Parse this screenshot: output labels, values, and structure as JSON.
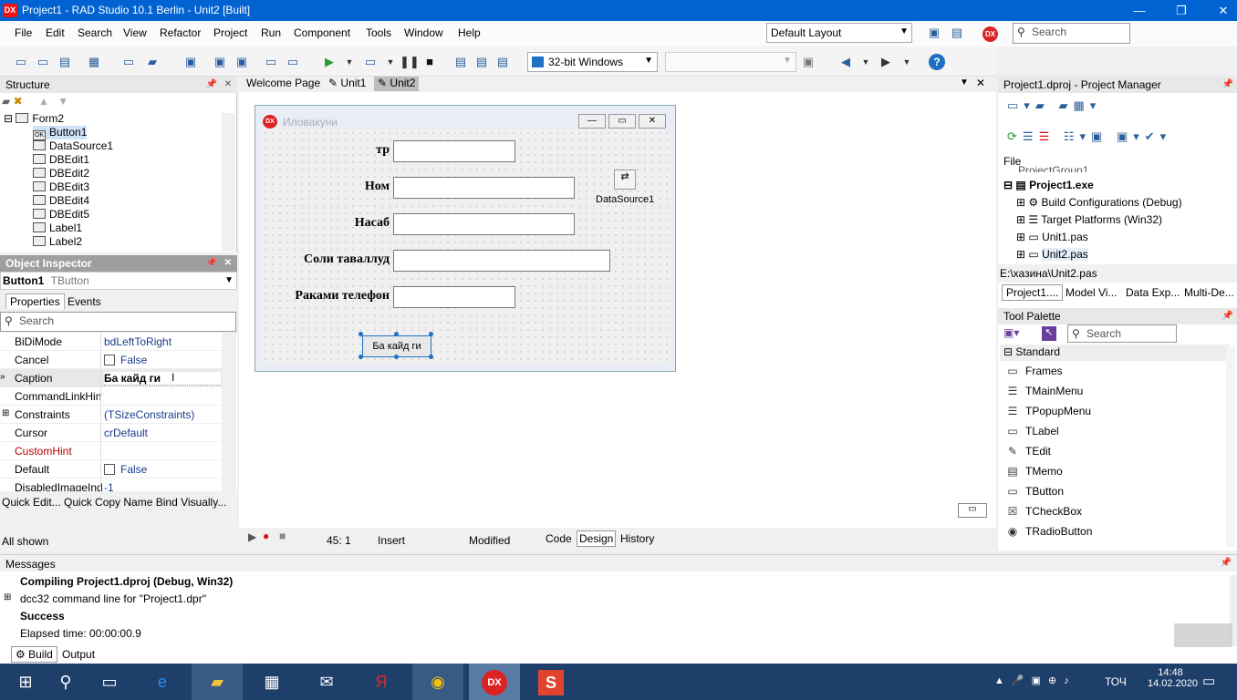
{
  "window": {
    "title": "Project1 - RAD Studio 10.1 Berlin - Unit2 [Built]",
    "logo": "DX"
  },
  "menu": [
    "File",
    "Edit",
    "Search",
    "View",
    "Refactor",
    "Project",
    "Run",
    "Component",
    "Tools",
    "Window",
    "Help"
  ],
  "layout_select": "Default Layout",
  "ide_search_placeholder": "Search",
  "platform": "32-bit Windows",
  "structure": {
    "title": "Structure",
    "items": [
      "Form2",
      "Button1",
      "DataSource1",
      "DBEdit1",
      "DBEdit2",
      "DBEdit3",
      "DBEdit4",
      "DBEdit5",
      "Label1",
      "Label2"
    ]
  },
  "object_inspector": {
    "title": "Object Inspector",
    "selected_name": "Button1",
    "selected_type": "TButton",
    "tabs": [
      "Properties",
      "Events"
    ],
    "search_placeholder": "Search",
    "props": [
      {
        "name": "BiDiMode",
        "value": "bdLeftToRight"
      },
      {
        "name": "Cancel",
        "value": "False"
      },
      {
        "name": "Caption",
        "value": "Ба кайд ги"
      },
      {
        "name": "CommandLinkHint",
        "value": ""
      },
      {
        "name": "Constraints",
        "value": "(TSizeConstraints)"
      },
      {
        "name": "Cursor",
        "value": "crDefault"
      },
      {
        "name": "CustomHint",
        "value": ""
      },
      {
        "name": "Default",
        "value": "False"
      },
      {
        "name": "DisabledImageIndex",
        "value": "-1"
      }
    ],
    "footer_links": "Quick Edit... Quick Copy Name Bind Visually...",
    "status": "All shown"
  },
  "editor_tabs": [
    "Welcome Page",
    "Unit1",
    "Unit2"
  ],
  "form": {
    "caption": "Иловакуни",
    "logo": "DX",
    "labels": [
      "тр",
      "Ном",
      "Насаб",
      "Соли таваллуд",
      "Раками телефон"
    ],
    "datasource_label": "DataSource1",
    "button_caption": "Ба кайд ги"
  },
  "editor_status": {
    "position": "45:  1",
    "mode": "Insert",
    "state": "Modified",
    "tabs": [
      "Code",
      "Design",
      "History"
    ]
  },
  "project_manager": {
    "title": "Project1.dproj - Project Manager",
    "file_label": "File",
    "group": "ProjectGroup1",
    "exe": "Project1.exe",
    "items": [
      "Build Configurations (Debug)",
      "Target Platforms (Win32)",
      "Unit1.pas",
      "Unit2.pas"
    ],
    "path": "E:\\хазина\\Unit2.pas",
    "tabs": [
      "Project1....",
      "Model Vi...",
      "Data Exp...",
      "Multi-De..."
    ]
  },
  "tool_palette": {
    "title": "Tool Palette",
    "search_placeholder": "Search",
    "category": "Standard",
    "items": [
      "Frames",
      "TMainMenu",
      "TPopupMenu",
      "TLabel",
      "TEdit",
      "TMemo",
      "TButton",
      "TCheckBox",
      "TRadioButton"
    ]
  },
  "messages": {
    "title": "Messages",
    "lines": [
      "Compiling Project1.dproj (Debug, Win32)",
      "dcc32 command line for \"Project1.dpr\"",
      "Success",
      "Elapsed time: 00:00:00.9"
    ],
    "tabs": [
      "Build",
      "Output"
    ]
  },
  "taskbar": {
    "time": "14:48",
    "date": "14.02.2020",
    "lang": "ТОЧ"
  }
}
